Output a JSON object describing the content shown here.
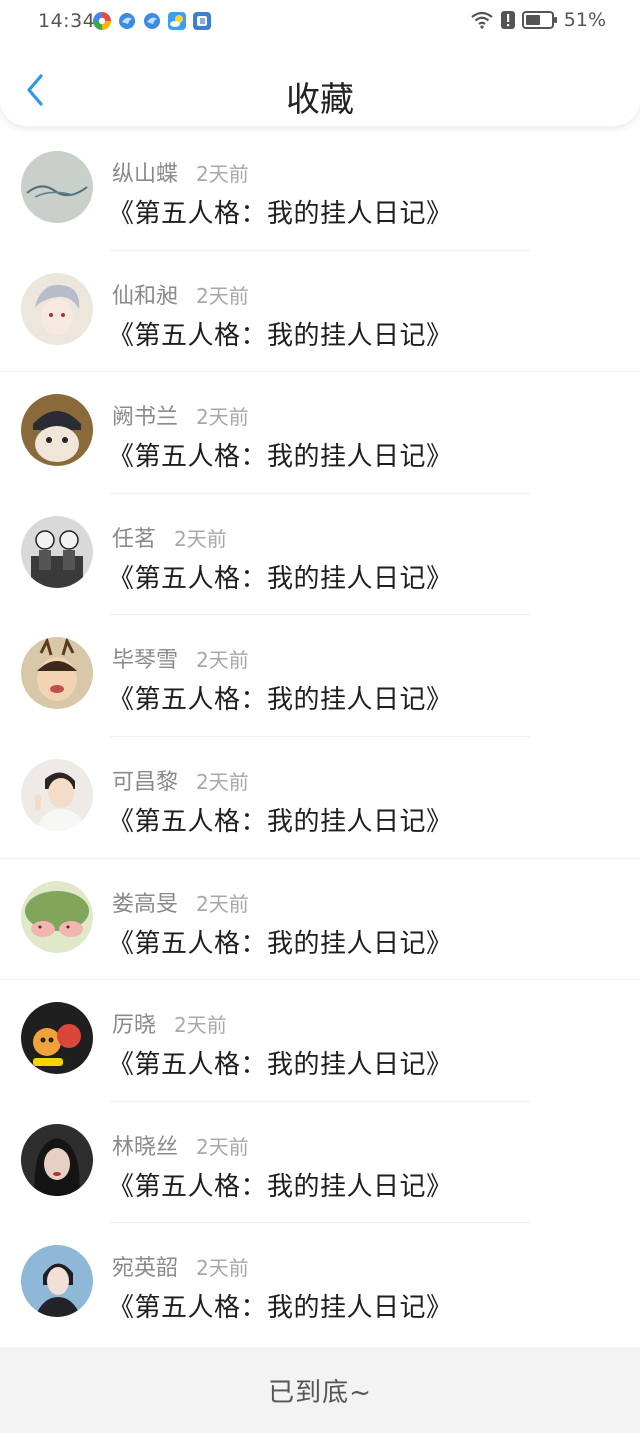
{
  "status_bar": {
    "time": "14:34",
    "battery_percent": "51%",
    "icons": [
      "colorful-app-icon",
      "blue-bird-icon",
      "blue-bird-icon",
      "weather-icon",
      "browser-e-icon"
    ]
  },
  "header": {
    "title": "收藏",
    "back_icon": "chevron-left-icon",
    "accent_color": "#2a9ae8"
  },
  "favorites": [
    {
      "name": "纵山蝶",
      "time": "2天前",
      "title": "《第五人格：我的挂人日记》"
    },
    {
      "name": "仙和昶",
      "time": "2天前",
      "title": "《第五人格：我的挂人日记》"
    },
    {
      "name": "阙书兰",
      "time": "2天前",
      "title": "《第五人格：我的挂人日记》"
    },
    {
      "name": "任茗",
      "time": "2天前",
      "title": "《第五人格：我的挂人日记》"
    },
    {
      "name": "毕琴雪",
      "time": "2天前",
      "title": "《第五人格：我的挂人日记》"
    },
    {
      "name": "可昌黎",
      "time": "2天前",
      "title": "《第五人格：我的挂人日记》"
    },
    {
      "name": "娄高旻",
      "time": "2天前",
      "title": "《第五人格：我的挂人日记》"
    },
    {
      "name": "厉晓",
      "time": "2天前",
      "title": "《第五人格：我的挂人日记》"
    },
    {
      "name": "林晓丝",
      "time": "2天前",
      "title": "《第五人格：我的挂人日记》"
    },
    {
      "name": "宛英韶",
      "time": "2天前",
      "title": "《第五人格：我的挂人日记》"
    }
  ],
  "footer": {
    "text": "已到底~"
  }
}
